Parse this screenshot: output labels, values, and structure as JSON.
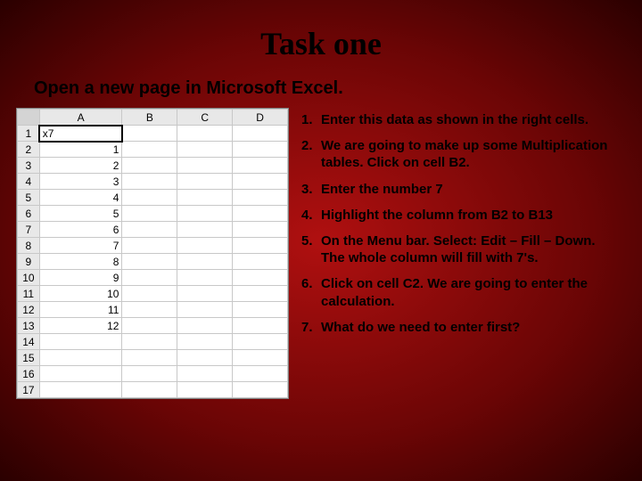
{
  "title": "Task one",
  "subtitle": "Open a new page in Microsoft Excel.",
  "sheet": {
    "columns": [
      "A",
      "B",
      "C",
      "D"
    ],
    "active_cell_value": "x7",
    "rows": [
      {
        "n": "1",
        "A": "x7"
      },
      {
        "n": "2",
        "A": "1"
      },
      {
        "n": "3",
        "A": "2"
      },
      {
        "n": "4",
        "A": "3"
      },
      {
        "n": "5",
        "A": "4"
      },
      {
        "n": "6",
        "A": "5"
      },
      {
        "n": "7",
        "A": "6"
      },
      {
        "n": "8",
        "A": "7"
      },
      {
        "n": "9",
        "A": "8"
      },
      {
        "n": "10",
        "A": "9"
      },
      {
        "n": "11",
        "A": "10"
      },
      {
        "n": "12",
        "A": "11"
      },
      {
        "n": "13",
        "A": "12"
      },
      {
        "n": "14",
        "A": ""
      },
      {
        "n": "15",
        "A": ""
      },
      {
        "n": "16",
        "A": ""
      },
      {
        "n": "17",
        "A": ""
      }
    ]
  },
  "steps": [
    {
      "n": "1.",
      "text": "Enter this data as shown in the right cells."
    },
    {
      "n": "2.",
      "text": "We are going to make up some Multiplication tables. Click on cell B2."
    },
    {
      "n": "3.",
      "text": "Enter the number 7"
    },
    {
      "n": "4.",
      "text": "Highlight the column from B2 to B13"
    },
    {
      "n": "5.",
      "text": "On the Menu bar. Select: Edit – Fill – Down. The whole column will fill with 7's."
    },
    {
      "n": "6.",
      "text": "Click on cell C2. We are going to enter the calculation."
    }
  ],
  "question": {
    "n": "7.",
    "text": "What do we need to enter first?"
  }
}
